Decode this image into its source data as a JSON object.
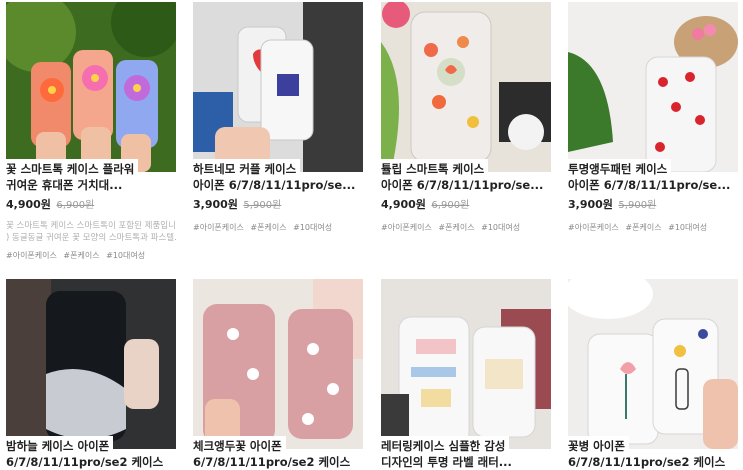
{
  "products": [
    {
      "title_line1": "꽃 스마트톡 케이스 플라워",
      "title_line2": "귀여운 휴대폰 거치대...",
      "price": "4,900원",
      "original_price": "6,900원",
      "desc_line1": "꽃 스마트톡 케이스 스마트톡이 포함된 제품입니다",
      "desc_line2": ") 동글동글 귀여운 꽃 모양의 스마트톡과 파스텔...",
      "tags": [
        "#아이폰케이스",
        "#폰케이스",
        "#10대여성"
      ]
    },
    {
      "title_line1": "하트네모 커플 케이스",
      "title_line2": "아이폰 6/7/8/11/11pro/se...",
      "price": "3,900원",
      "original_price": "5,900원",
      "tags": [
        "#아이폰케이스",
        "#폰케이스",
        "#10대여성"
      ]
    },
    {
      "title_line1": "튤립 스마트톡 케이스",
      "title_line2": "아이폰 6/7/8/11/11pro/se...",
      "price": "4,900원",
      "original_price": "6,900원",
      "tags": [
        "#아이폰케이스",
        "#폰케이스",
        "#10대여성"
      ]
    },
    {
      "title_line1": "투명앵두패턴 케이스",
      "title_line2": "아이폰 6/7/8/11/11pro/se...",
      "price": "3,900원",
      "original_price": "5,900원",
      "tags": [
        "#아이폰케이스",
        "#폰케이스",
        "#10대여성"
      ]
    },
    {
      "title_line1": "밤하늘 케이스 아이폰",
      "title_line2": "6/7/8/11/11pro/se2 케이스"
    },
    {
      "title_line1": "체크앵두꽃 아이폰",
      "title_line2": "6/7/8/11/11pro/se2 케이스"
    },
    {
      "title_line1": "레터링케이스 심플한 감성",
      "title_line2": "디자인의 투명 라벨 래터..."
    },
    {
      "title_line1": "꽃병 아이폰",
      "title_line2": "6/7/8/11/11pro/se2 케이스"
    }
  ]
}
